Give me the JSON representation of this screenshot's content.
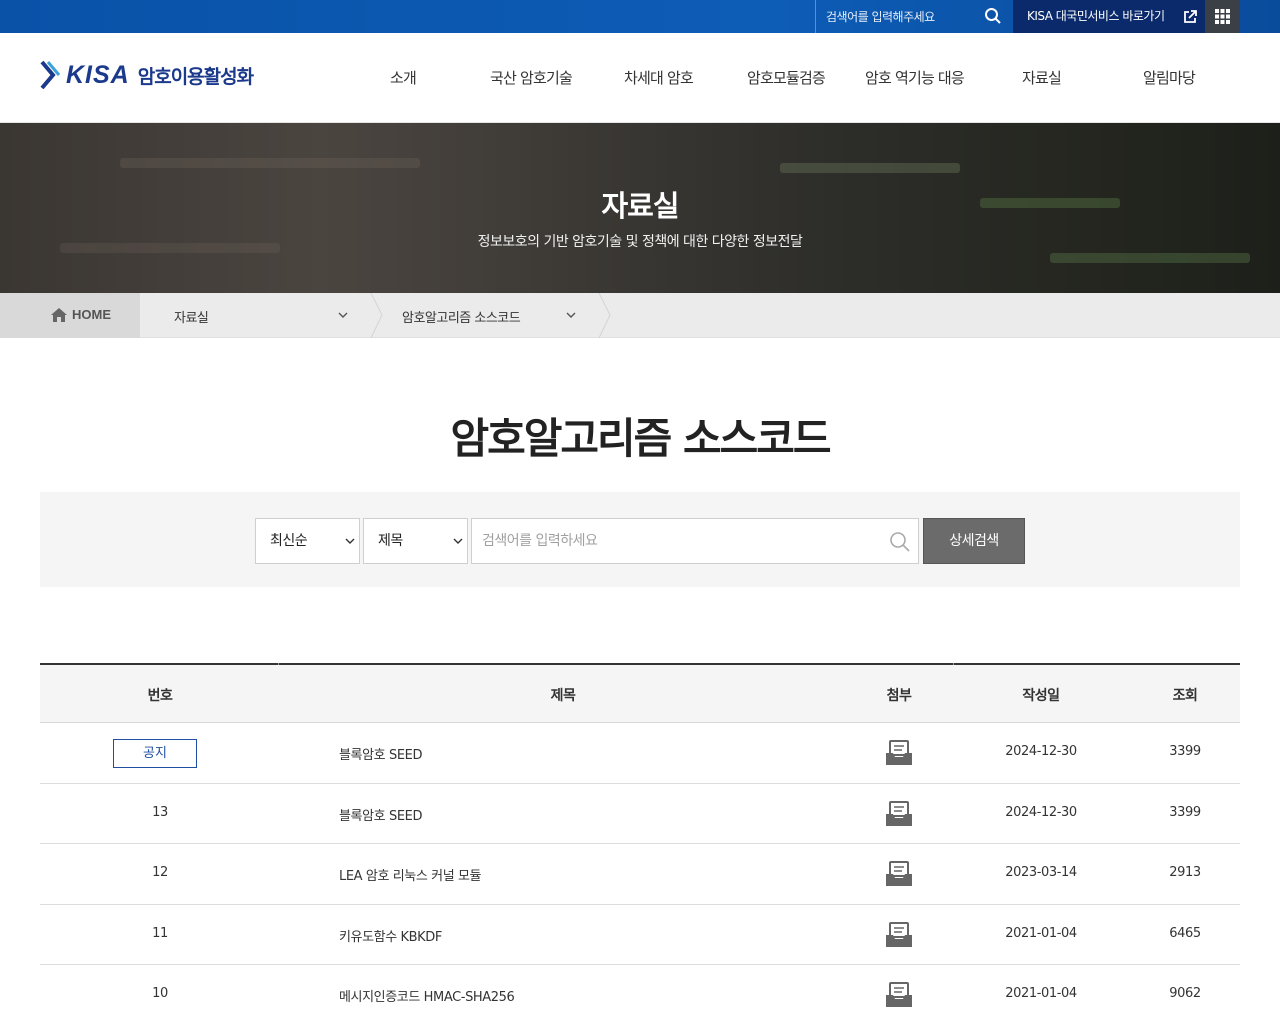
{
  "topbar": {
    "search_placeholder": "검색어를 입력해주세요",
    "service_link": "KISA 대국민서비스 바로가기"
  },
  "header": {
    "logo_brand": "KISA",
    "logo_text": "암호이용활성화",
    "nav": [
      "소개",
      "국산 암호기술",
      "차세대 암호",
      "암호모듈검증",
      "암호 역기능 대응",
      "자료실",
      "알림마당"
    ]
  },
  "hero": {
    "title": "자료실",
    "subtitle": "정보보호의 기반 암호기술 및 정책에 대한 다양한 정보전달"
  },
  "breadcrumb": {
    "home": "HOME",
    "level1": "자료실",
    "level2": "암호알고리즘 소스코드"
  },
  "page_title": "암호알고리즘 소스코드",
  "search": {
    "sort_value": "최신순",
    "field_value": "제목",
    "input_placeholder": "검색어를 입력하세요",
    "button_label": "상세검색"
  },
  "table": {
    "headers": {
      "number": "번호",
      "title": "제목",
      "attach": "첨부",
      "date": "작성일",
      "views": "조회"
    },
    "notice_label": "공지",
    "rows": [
      {
        "number": "공지",
        "title": "블록암호 SEED",
        "date": "2024-12-30",
        "views": "3399"
      },
      {
        "number": "13",
        "title": "블록암호 SEED",
        "date": "2024-12-30",
        "views": "3399"
      },
      {
        "number": "12",
        "title": "LEA 암호 리눅스 커널 모듈",
        "date": "2023-03-14",
        "views": "2913"
      },
      {
        "number": "11",
        "title": "키유도함수 KBKDF",
        "date": "2021-01-04",
        "views": "6465"
      },
      {
        "number": "10",
        "title": "메시지인증코드 HMAC-SHA256",
        "date": "2021-01-04",
        "views": "9062"
      }
    ]
  },
  "colors": {
    "topbar_blue": "#0d5cb6",
    "service_navy": "#0b2a6b",
    "brand_navy": "#1b3a8c",
    "notice_blue": "#1f4ea3",
    "button_gray": "#6b6b6b"
  },
  "icons": [
    "search-icon",
    "external-link-icon",
    "grid-menu-icon",
    "home-icon",
    "chevron-down-icon",
    "attachment-icon"
  ]
}
